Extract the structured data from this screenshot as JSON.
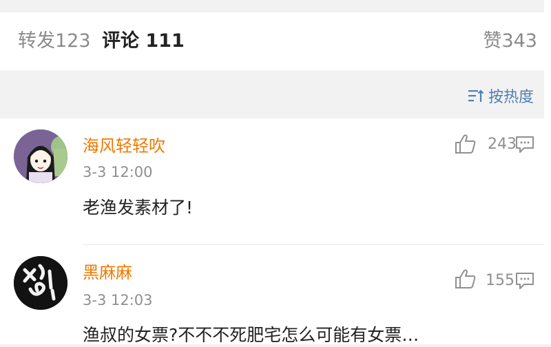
{
  "tabs": {
    "repost": "转发123",
    "comments": "评论 111",
    "likes": "赞343"
  },
  "sort": {
    "label": "按热度"
  },
  "comments": [
    {
      "username": "海风轻轻吹",
      "time": "3-3  12:00",
      "text": "老渔发素材了!",
      "like_count": "243"
    },
    {
      "username": "黑麻麻",
      "time": "3-3  12:03",
      "text": "渔叔的女票?不不不死肥宅怎么可能有女票…",
      "like_count": "155"
    }
  ],
  "colors": {
    "accent": "#ff8200",
    "username": "#f07800",
    "link": "#4e7fb1"
  },
  "icons": [
    "sort-icon",
    "thumbs-up-icon",
    "comment-reply-icon"
  ]
}
